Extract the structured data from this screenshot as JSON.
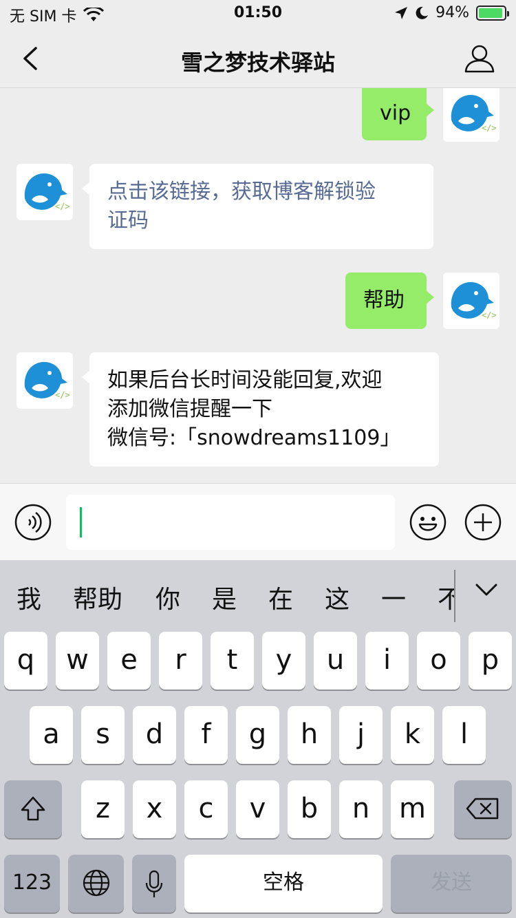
{
  "status_bar": {
    "carrier": "无 SIM 卡",
    "time": "01:50",
    "battery": "94%",
    "battery_level": 0.94,
    "icons": [
      "wifi-icon",
      "location-icon",
      "moon-icon",
      "battery-charging-icon"
    ]
  },
  "nav": {
    "title": "雪之梦技术驿站",
    "icons": [
      "back-chevron-icon",
      "profile-icon"
    ]
  },
  "messages": [
    {
      "side": "sent",
      "text": "vip"
    },
    {
      "side": "recv",
      "lines": [
        "点击该链接，获取博客解锁验",
        "证码"
      ],
      "style": "link"
    },
    {
      "side": "sent",
      "text": "帮助"
    },
    {
      "side": "recv",
      "lines": [
        "如果后台长时间没能回复,欢迎",
        "添加微信提醒一下",
        "微信号:「snowdreams1109」"
      ]
    }
  ],
  "input_bar": {
    "value": "",
    "icons": [
      "voice-icon",
      "emoji-icon",
      "plus-icon"
    ]
  },
  "keyboard": {
    "candidates": [
      "我",
      "帮助",
      "你",
      "是",
      "在",
      "这",
      "一",
      "不"
    ],
    "row1": [
      "q",
      "w",
      "e",
      "r",
      "t",
      "y",
      "u",
      "i",
      "o",
      "p"
    ],
    "row2": [
      "a",
      "s",
      "d",
      "f",
      "g",
      "h",
      "j",
      "k",
      "l"
    ],
    "row3": [
      "z",
      "x",
      "c",
      "v",
      "b",
      "n",
      "m"
    ],
    "numbers_key": "123",
    "space_key": "空格",
    "send_key": "发送",
    "icons": [
      "shift-icon",
      "delete-icon",
      "globe-icon",
      "microphone-icon",
      "chevron-down-icon"
    ]
  }
}
